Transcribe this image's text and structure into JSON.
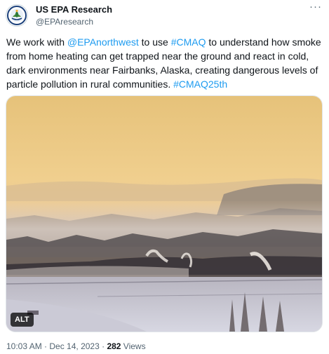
{
  "author": {
    "name": "US EPA Research",
    "handle": "@EPAresearch",
    "avatar_icon": "epa-seal-icon"
  },
  "more_icon": "more-icon",
  "more_glyph": "···",
  "tweet": {
    "p1": "We work with ",
    "mention": "@EPAnorthwest",
    "p2": " to use ",
    "hashtag1": "#CMAQ",
    "p3": " to understand how smoke from home heating can get trapped near the ground and react in cold, dark environments near Fairbanks, Alaska, creating dangerous levels of particle pollution in rural communities. ",
    "hashtag2": "#CMAQ25th"
  },
  "media": {
    "alt_badge": "ALT"
  },
  "meta": {
    "time": "10:03 AM",
    "sep1": " · ",
    "date": "Dec 14, 2023",
    "sep2": " · ",
    "views_count": "282",
    "views_label": " Views"
  },
  "colors": {
    "link": "#1d9bf0",
    "text": "#0f1419",
    "secondary": "#536471",
    "sky_top": "#e8c47a",
    "fog": "#d7cfc6"
  }
}
